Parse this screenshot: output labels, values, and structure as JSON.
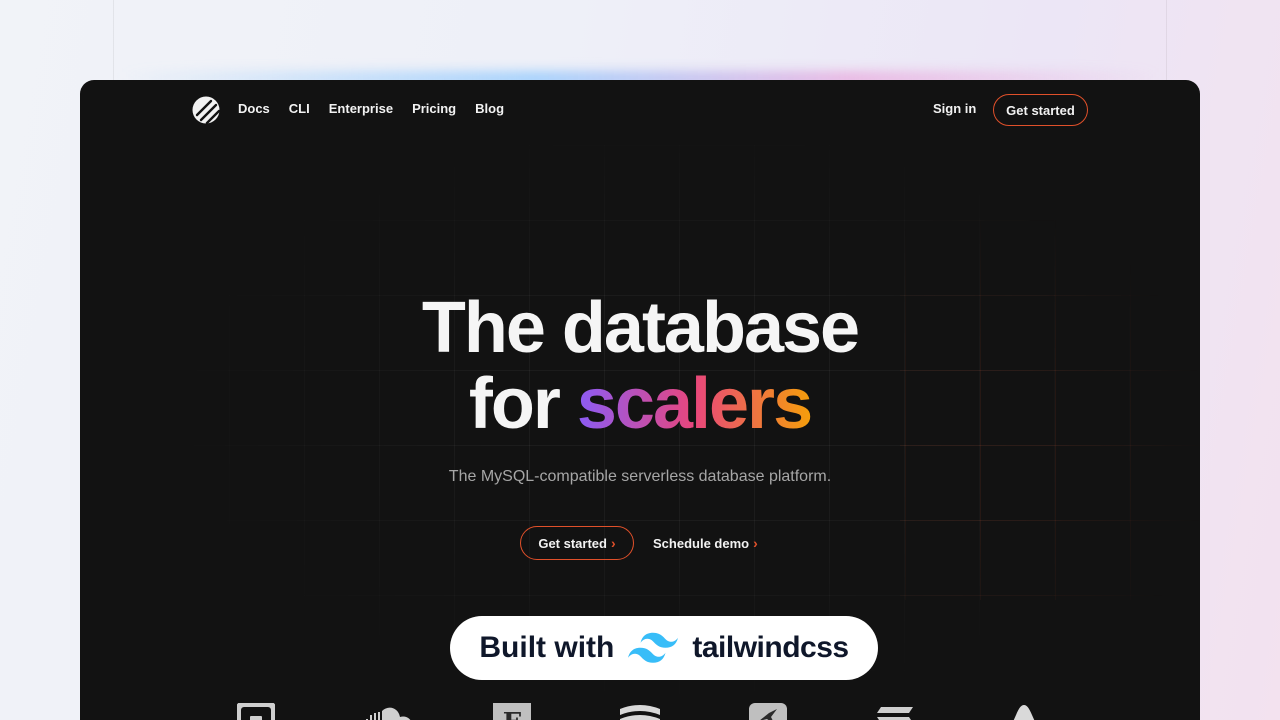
{
  "nav": {
    "links": [
      "Docs",
      "CLI",
      "Enterprise",
      "Pricing",
      "Blog"
    ],
    "sign_in": "Sign in",
    "cta": "Get started"
  },
  "hero": {
    "title_line1": "The database",
    "title_line2_prefix": "for",
    "title_line2_highlight": "scalers",
    "subtitle": "The MySQL-compatible serverless database platform.",
    "primary_button": "Get started",
    "secondary_button": "Schedule demo"
  },
  "badge": {
    "prefix": "Built with",
    "brand": "tailwindcss"
  },
  "customer_logos": [
    "square-logo",
    "soundcloud-logo",
    "f-logo",
    "stack-logo",
    "bird-logo",
    "s-logo",
    "triangle-logo"
  ],
  "colors": {
    "accent": "#e0502a",
    "background": "#121212",
    "gradient": [
      "#8b5cf6",
      "#e8467c",
      "#f59e0b"
    ],
    "tailwind": "#38bdf8"
  }
}
